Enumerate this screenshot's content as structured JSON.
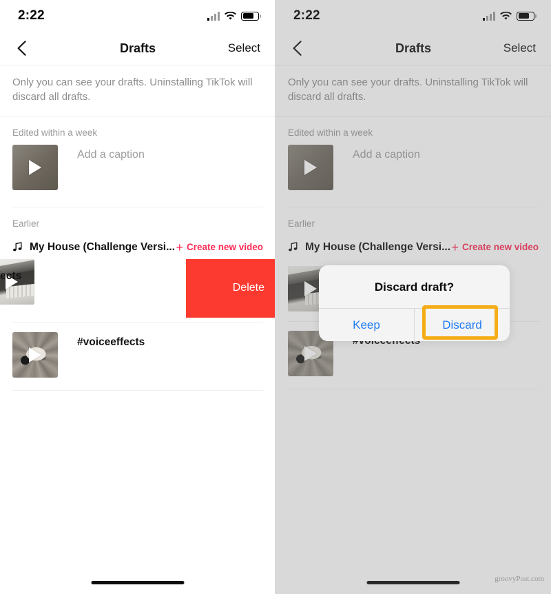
{
  "status_bar": {
    "time": "2:22",
    "signal_icon": "cellular-signal-icon",
    "wifi_icon": "wifi-icon",
    "battery_icon": "battery-icon"
  },
  "nav": {
    "back_icon": "chevron-left-icon",
    "title": "Drafts",
    "action_label": "Select"
  },
  "notice": "Only you can see your drafts. Uninstalling TikTok will discard all drafts.",
  "sections": [
    {
      "label": "Edited within a week",
      "items": [
        {
          "caption": "Add a caption",
          "thumb_kind": "plain",
          "play_icon": "play-icon"
        }
      ]
    },
    {
      "label": "Earlier",
      "music": {
        "note_icon": "music-note-icon",
        "title": "My House (Challenge Versi...",
        "create_label": "Create new video",
        "plus_icon": "plus-icon"
      },
      "swipe_row": {
        "caption_visible": "ceeffects",
        "caption_full": "#voiceeffects",
        "delete_label": "Delete",
        "thumb_kind": "desk"
      },
      "items": [
        {
          "caption": "#voiceeffects",
          "thumb_kind": "cat",
          "play_icon": "play-icon"
        }
      ]
    }
  ],
  "right_panel": {
    "music_title": "My House (Challenge Versi...",
    "create_label": "Create new video",
    "caption": "#voiceeffects"
  },
  "dialog": {
    "title": "Discard draft?",
    "keep_label": "Keep",
    "discard_label": "Discard"
  },
  "watermark": "groovyPost.com",
  "colors": {
    "accent_red": "#fe2c55",
    "delete_red": "#fd3a30",
    "dialog_blue": "#1f7bf2",
    "highlight_yellow": "#f5ad17",
    "muted_text": "#8d8d8d"
  }
}
